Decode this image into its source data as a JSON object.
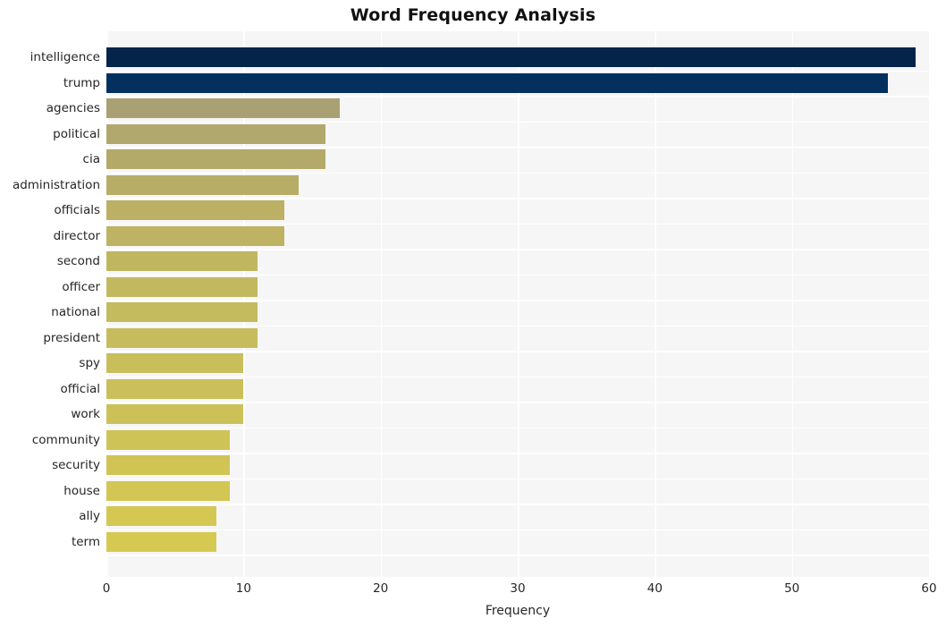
{
  "chart_data": {
    "type": "bar",
    "orientation": "horizontal",
    "title": "Word Frequency Analysis",
    "xlabel": "Frequency",
    "ylabel": "",
    "xlim": [
      0,
      60
    ],
    "xticks": [
      0,
      10,
      20,
      30,
      40,
      50,
      60
    ],
    "xtick_labels": [
      "0",
      "10",
      "20",
      "30",
      "40",
      "50",
      "60"
    ],
    "grid": true,
    "legend": "none",
    "categories": [
      "intelligence",
      "trump",
      "agencies",
      "political",
      "cia",
      "administration",
      "officials",
      "director",
      "second",
      "officer",
      "national",
      "president",
      "spy",
      "official",
      "work",
      "community",
      "security",
      "house",
      "ally",
      "term"
    ],
    "values": [
      59,
      57,
      17,
      16,
      16,
      14,
      13,
      13,
      11,
      11,
      11,
      11,
      10,
      10,
      10,
      9,
      9,
      9,
      8,
      8
    ],
    "bar_colors": [
      "#042449",
      "#03305f",
      "#a9a173",
      "#b0a86c",
      "#b3a969",
      "#b7ad66",
      "#bbb063",
      "#bdb362",
      "#c0b660",
      "#c2b85f",
      "#c4ba5e",
      "#c6bc5d",
      "#c8be5c",
      "#cabf5a",
      "#ccc159",
      "#cec357",
      "#d0c455",
      "#d2c654",
      "#d4c853",
      "#d6c952"
    ],
    "plot_background": "#f6f6f6",
    "grid_color": "#ffffff",
    "figure_background": "#ffffff",
    "text_color": "#262626"
  }
}
